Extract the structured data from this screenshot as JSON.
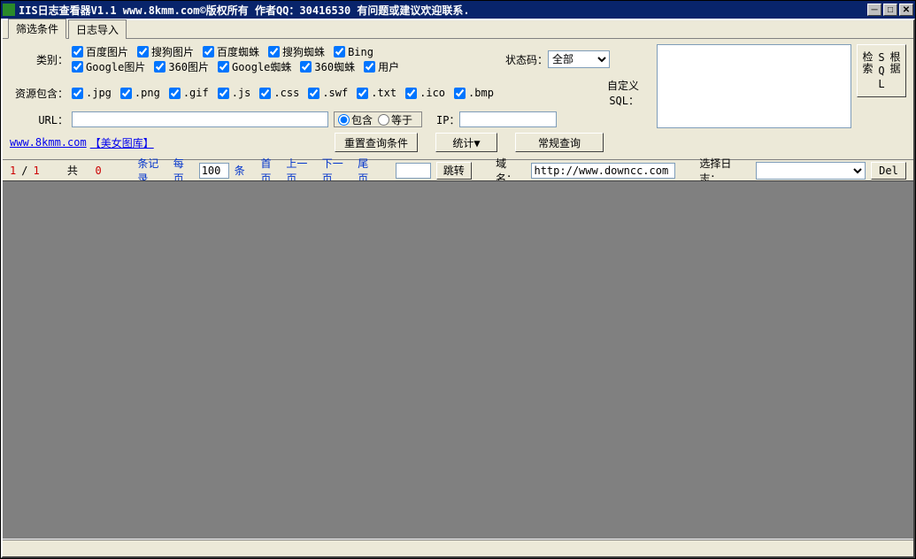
{
  "titlebar": {
    "text": "IIS日志查看器V1.1   www.8kmm.com©版权所有   作者QQ：30416530 有问题或建议欢迎联系."
  },
  "tabs": {
    "filter": "筛选条件",
    "import": "日志导入"
  },
  "labels": {
    "category": "类别：",
    "resource": "资源包含：",
    "url": "URL：",
    "ip": "IP：",
    "status": "状态码：",
    "customSql": "自定义\nSQL："
  },
  "categories_row1": [
    "百度图片",
    "搜狗图片",
    "百度蜘蛛",
    "搜狗蜘蛛",
    "Bing"
  ],
  "categories_row2": [
    "Google图片",
    "360图片",
    "Google蜘蛛",
    "360蜘蛛",
    "用户"
  ],
  "resources": [
    ".jpg",
    ".png",
    ".gif",
    ".js",
    ".css",
    ".swf",
    ".txt",
    ".ico",
    ".bmp"
  ],
  "radios": {
    "contain": "包含",
    "equal": "等于"
  },
  "status_options": [
    "全部"
  ],
  "status_value": "全部",
  "links": {
    "site": "www.8kmm.com",
    "gallery": "【美女图库】"
  },
  "buttons": {
    "reset": "重置查询条件",
    "stats": "统计▼",
    "query": "常规查询",
    "sqlsearch": "根据SQL检索",
    "jump": "跳转",
    "del": "Del"
  },
  "pager": {
    "cur": "1",
    "sep": "/",
    "total": "1",
    "totalLabel": "共",
    "totalCount": "0",
    "records": "条记录",
    "perpage": "每页",
    "unit": "条",
    "pagesize": "100",
    "first": "首页",
    "prev": "上一页",
    "next": "下一页",
    "last": "尾页",
    "jumpVal": "",
    "domainLabel": "域名：",
    "domainValue": "http://www.downcc.com",
    "logLabel": "选择日志：",
    "logValue": ""
  }
}
